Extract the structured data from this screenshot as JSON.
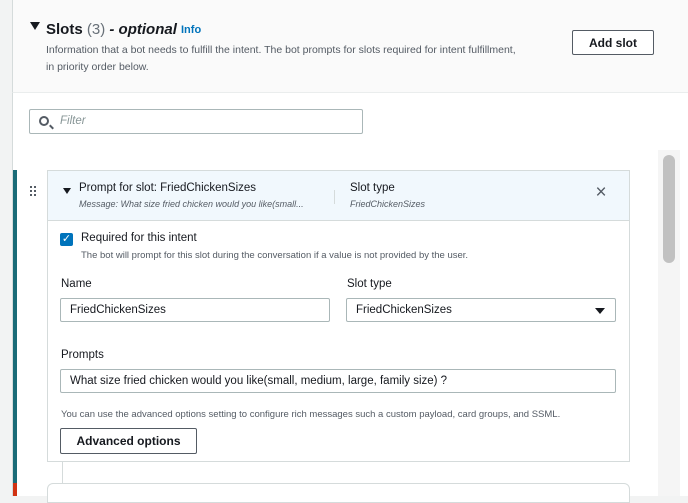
{
  "section": {
    "title": "Slots",
    "count": "(3)",
    "optional": "- optional",
    "info_link": "Info",
    "description": "Information that a bot needs to fulfill the intent. The bot prompts for slots required for intent fulfillment, in priority order below.",
    "add_slot_label": "Add slot"
  },
  "filter": {
    "placeholder": "Filter"
  },
  "slot": {
    "header_title": "Prompt for slot: FriedChickenSizes",
    "header_message": "Message: What size fried chicken would you like(small...",
    "header_slot_type_label": "Slot type",
    "header_slot_type_value": "FriedChickenSizes",
    "close_icon": "×",
    "required_label": "Required for this intent",
    "required_checked": true,
    "required_desc": "The bot will prompt for this slot during the conversation if a value is not provided by the user.",
    "name_label": "Name",
    "name_value": "FriedChickenSizes",
    "slot_type_label": "Slot type",
    "slot_type_value": "FriedChickenSizes",
    "prompts_label": "Prompts",
    "prompts_value": "What size fried chicken would you like(small, medium, large, family size) ?",
    "advanced_desc": "You can use the advanced options setting to configure rich messages such a custom payload, card groups, and SSML.",
    "advanced_label": "Advanced options"
  },
  "colors": {
    "accent": "#1a6b77",
    "link": "#0073bb",
    "checkbox": "#0073bb"
  }
}
